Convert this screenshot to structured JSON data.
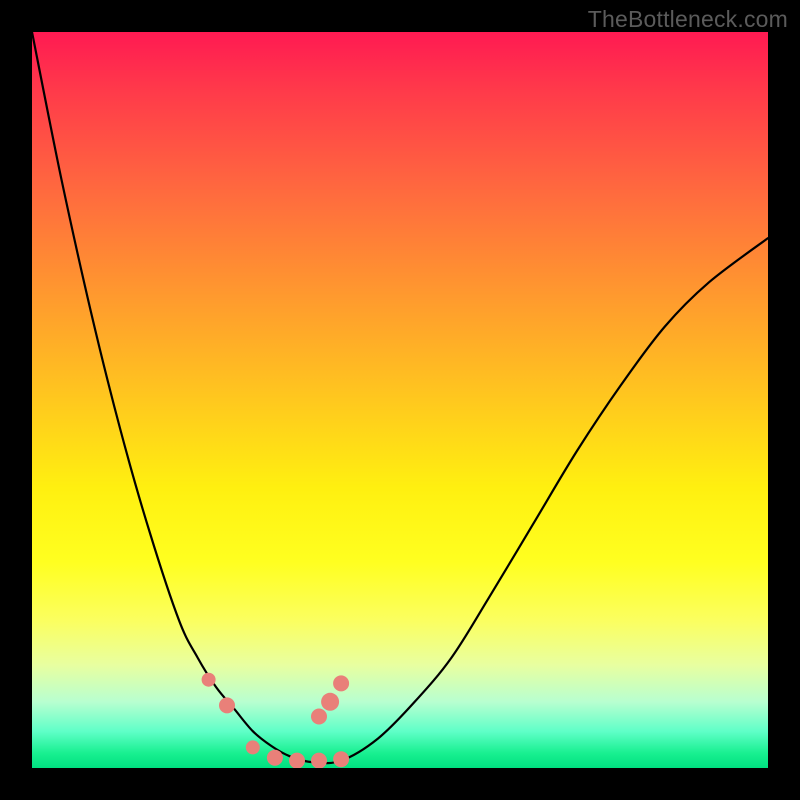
{
  "watermark": "TheBottleneck.com",
  "chart_data": {
    "type": "line",
    "title": "",
    "xlabel": "",
    "ylabel": "",
    "xlim": [
      0,
      1
    ],
    "ylim": [
      0,
      1
    ],
    "grid": false,
    "legend": false,
    "series": [
      {
        "name": "curve",
        "x": [
          0.0,
          0.04,
          0.08,
          0.12,
          0.16,
          0.2,
          0.225,
          0.25,
          0.275,
          0.3,
          0.325,
          0.35,
          0.38,
          0.42,
          0.47,
          0.52,
          0.57,
          0.62,
          0.68,
          0.74,
          0.8,
          0.86,
          0.92,
          1.0
        ],
        "y": [
          1.0,
          0.8,
          0.62,
          0.46,
          0.32,
          0.2,
          0.15,
          0.11,
          0.08,
          0.05,
          0.03,
          0.016,
          0.008,
          0.01,
          0.04,
          0.09,
          0.15,
          0.23,
          0.33,
          0.43,
          0.52,
          0.6,
          0.66,
          0.72
        ]
      }
    ],
    "markers": {
      "name": "pink-dots",
      "x": [
        0.24,
        0.265,
        0.3,
        0.33,
        0.36,
        0.39,
        0.42,
        0.39,
        0.405,
        0.42
      ],
      "y": [
        0.12,
        0.085,
        0.028,
        0.014,
        0.01,
        0.01,
        0.012,
        0.07,
        0.09,
        0.115
      ],
      "r": [
        7,
        8,
        7,
        8,
        8,
        8,
        8,
        8,
        9,
        8
      ]
    },
    "colors": {
      "curve": "#000000",
      "markers": "#e98079",
      "gradient_top": "#ff1a52",
      "gradient_bottom": "#00e080"
    }
  }
}
